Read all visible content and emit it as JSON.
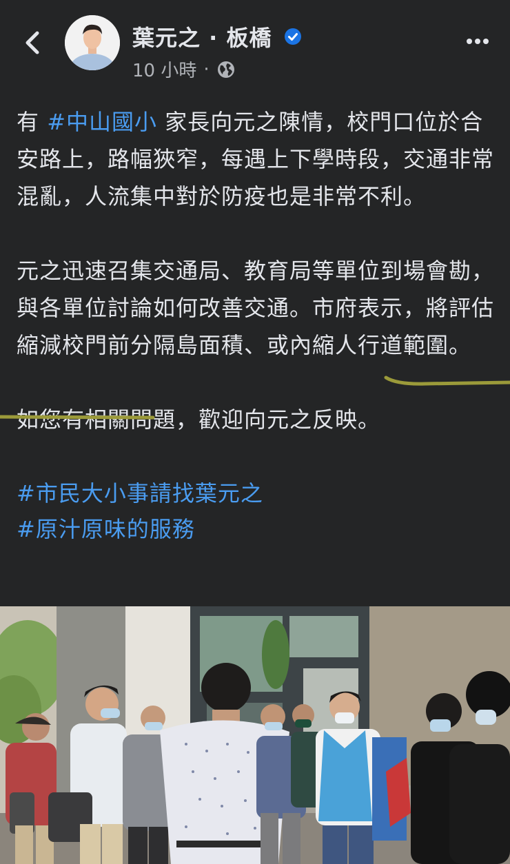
{
  "post": {
    "author": "葉元之 · 板橋",
    "time": "10 小時",
    "dot": "·",
    "paragraphs": [
      {
        "before": "有 ",
        "hashtag": "#中山國小",
        "after": " 家長向元之陳情，校門口位於合安路上，路幅狹窄，每遇上下學時段，交通非常混亂，人流集中對於防疫也是非常不利。"
      },
      {
        "text": "元之迅速召集交通局、教育局等單位到場會勘，與各單位討論如何改善交通。市府表示，將評估縮減校門前分隔島面積、或內縮人行道範圍。"
      },
      {
        "text": "如您有相關問題，歡迎向元之反映。"
      }
    ],
    "tags": [
      "#市民大小事請找葉元之",
      "#原汁原味的服務"
    ]
  },
  "icons": {
    "back": "chevron-left-icon",
    "verified": "verified-badge-icon",
    "audience": "globe-icon",
    "more": "more-horizontal-icon"
  },
  "colors": {
    "background": "#242526",
    "text": "#e4e6eb",
    "secondary_text": "#b0b3b8",
    "link": "#4a9cf0",
    "verified": "#1b74e4",
    "highlight_underline": "#9b9a3a"
  }
}
